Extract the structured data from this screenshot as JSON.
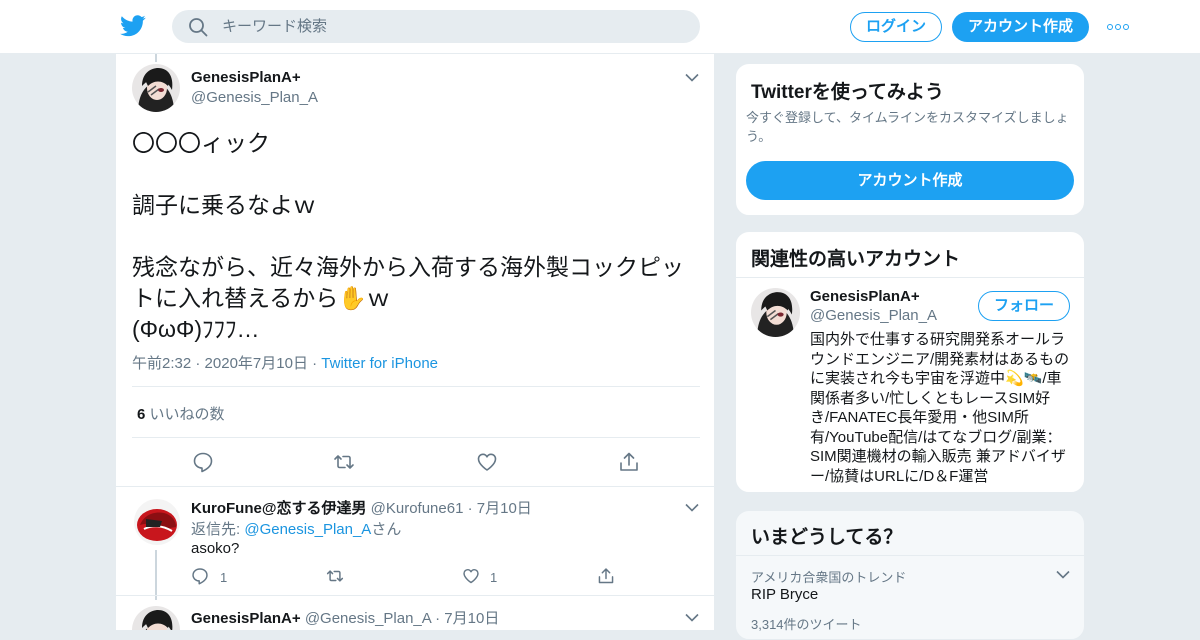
{
  "header": {
    "search_placeholder": "キーワード検索",
    "login_label": "ログイン",
    "signup_label": "アカウント作成",
    "brand_color": "#1da1f2"
  },
  "main_tweet": {
    "display_name": "GenesisPlanA+",
    "handle": "@Genesis_Plan_A",
    "text": "〇〇〇ィック\n\n調子に乗るなよｗ\n\n残念ながら、近々海外から入荷する海外製コックピットに入れ替えるから✋ｗ\n(ΦωΦ)ﾌﾌﾌ…",
    "time": "午前2:32",
    "date": "2020年7月10日",
    "source": "Twitter for iPhone",
    "like_count": "6",
    "like_label": "いいねの数"
  },
  "replies": [
    {
      "display_name": "KuroFune@恋する伊達男",
      "handle": "@Kurofune61",
      "date": "7月10日",
      "reply_to_prefix": "返信先: ",
      "reply_to_handle": "@Genesis_Plan_A",
      "reply_to_suffix": "さん",
      "text": "asoko?",
      "reply_count": "1",
      "like_count": "1"
    },
    {
      "display_name": "GenesisPlanA+",
      "handle": "@Genesis_Plan_A",
      "date": "7月10日"
    }
  ],
  "sidebar": {
    "try_card": {
      "title": "Twitterを使ってみよう",
      "subtitle": "今すぐ登録して、タイムラインをカスタマイズしましょう。",
      "button_label": "アカウント作成"
    },
    "related_card": {
      "title": "関連性の高いアカウント",
      "display_name": "GenesisPlanA+",
      "handle": "@Genesis_Plan_A",
      "follow_label": "フォロー",
      "bio": "国内外で仕事する研究開発系オールラウンドエンジニア/開発素材はあるものに実装され今も宇宙を浮遊中💫🛰️/車関係者多い/忙しくともレースSIM好き/FANATEC長年愛用・他SIM所有/YouTube配信/はてなブログ/副業：SIM関連機材の輸入販売 兼アドバイザー/協賛はURLに/D＆F運営"
    },
    "trend_card": {
      "title": "いまどうしてる？",
      "context": "アメリカ合衆国のトレンド",
      "topic": "RIP Bryce",
      "count": "3,314件のツイート"
    }
  }
}
